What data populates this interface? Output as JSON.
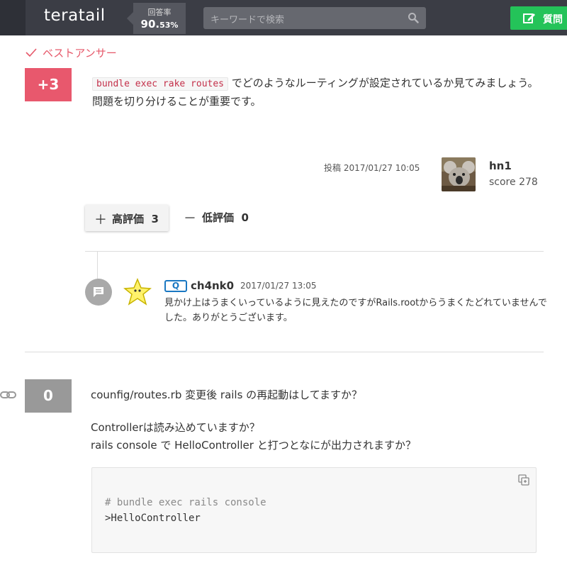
{
  "header": {
    "logo": "teratail",
    "rate_label": "回答率",
    "rate_value": "90.",
    "rate_decimal": "53%",
    "search_placeholder": "キーワードで検索",
    "ask_button": "質問"
  },
  "best_answer": {
    "label": "ベストアンサー",
    "score": "+3",
    "code": "bundle exec rake routes",
    "text_after_code": " でどのようなルーティングが設定されているか見てみましょう。",
    "line2": "問題を切り分けることが重要です。",
    "post_meta": "投稿 2017/01/27 10:05",
    "user_name": "hn1",
    "user_score": "score 278",
    "vote_up_label": "高評価",
    "vote_up_count": "3",
    "vote_down_label": "低評価",
    "vote_down_count": "0",
    "comment": {
      "badge": "Q",
      "user": "ch4nk0",
      "date": "2017/01/27 13:05",
      "text": "見かけ上はうまくいっているように見えたのですがRails.rootからうまくたどれていませんでした。ありがとうございます。"
    }
  },
  "answer2": {
    "score": "0",
    "line1": "counfig/routes.rb 変更後 rails の再起動はしてますか？",
    "line2": "Controllerは読み込めていますか？",
    "line3": "rails console で HelloController と打つとなにが出力されますか？",
    "code_comment": "# bundle exec rails console",
    "code_main": ">HelloController"
  },
  "colors": {
    "header_bg": "#3b3d45",
    "accent_red": "#e8586d",
    "ask_green": "#24c359",
    "badge_blue": "#1a78c2"
  }
}
